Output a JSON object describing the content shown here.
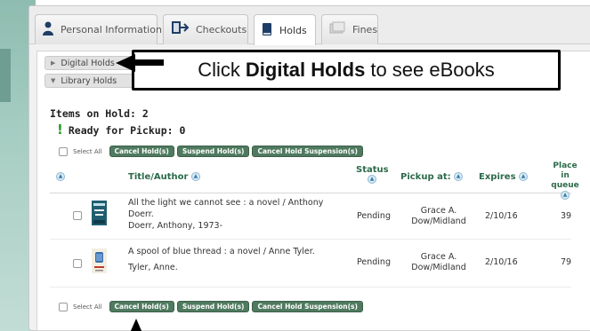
{
  "tabs": [
    {
      "label": "Personal Information",
      "icon": "person-icon"
    },
    {
      "label": "Checkouts",
      "icon": "checkout-icon"
    },
    {
      "label": "Holds",
      "icon": "book-icon"
    },
    {
      "label": "Fines",
      "icon": "fines-icon"
    }
  ],
  "accordion": {
    "digital_holds": "Digital Holds",
    "library_holds": "Library Holds"
  },
  "callout": {
    "prefix": "Click",
    "bold": "Digital Holds",
    "suffix": "to see eBooks"
  },
  "summary": {
    "items_on_hold": "Items on Hold: 2",
    "ready_for_pickup": "Ready for Pickup: 0"
  },
  "actions": {
    "select_all": "Select All",
    "cancel": "Cancel Hold(s)",
    "suspend": "Suspend Hold(s)",
    "cancel_suspension": "Cancel Hold Suspension(s)"
  },
  "columns": {
    "title": "Title/Author",
    "status": "Status",
    "pickup": "Pickup at:",
    "expires": "Expires",
    "place": "Place in queue"
  },
  "rows": [
    {
      "title": "All the light we cannot see : a novel / Anthony Doerr.",
      "author": "Doerr, Anthony, 1973-",
      "status": "Pending",
      "pickup": "Grace A. Dow/Midland",
      "expires": "2/10/16",
      "place": "39"
    },
    {
      "title": "A spool of blue thread : a novel / Anne Tyler.",
      "author": "Tyler, Anne.",
      "status": "Pending",
      "pickup": "Grace A. Dow/Midland",
      "expires": "2/10/16",
      "place": "79"
    }
  ],
  "colors": {
    "header_green": "#2c6a4a",
    "button_green": "#4f7a5f",
    "ready_green": "#2f9a2f"
  }
}
